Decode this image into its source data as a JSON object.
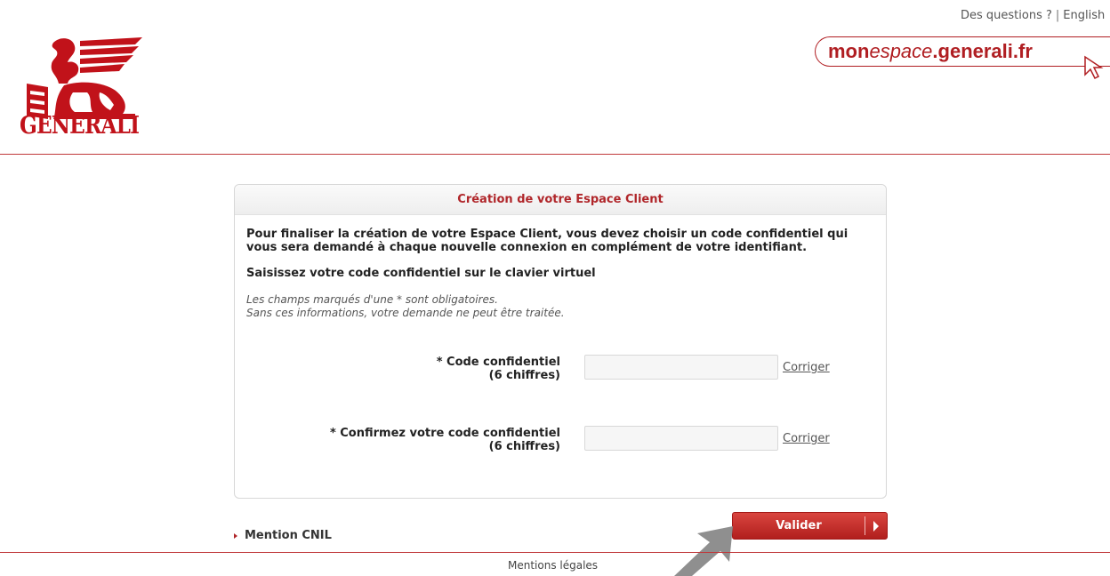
{
  "topbar": {
    "questions_label": "Des questions ?",
    "separator": "|",
    "language_label": "English"
  },
  "logo": {
    "brand": "GENERALI",
    "color": "#c1121a"
  },
  "badge": {
    "part1": "mon",
    "part2": "espace",
    "part3": ".generali.fr",
    "color": "#b01e22"
  },
  "panel": {
    "title": "Création de votre Espace Client",
    "intro": "Pour finaliser la création de votre Espace Client, vous devez choisir un code confidentiel qui vous sera demandé à chaque nouvelle connexion en complément de votre identifiant.",
    "instruction": "Saisissez votre code confidentiel sur le clavier virtuel",
    "note_line1": "Les champs marqués d'une * sont obligatoires.",
    "note_line2": "Sans ces informations, votre demande ne peut être traitée.",
    "fields": [
      {
        "label": "* Code confidentiel",
        "sublabel": "(6 chiffres)",
        "value": "",
        "fix_label": "Corriger"
      },
      {
        "label": "* Confirmez votre code confidentiel",
        "sublabel": "(6 chiffres)",
        "value": "",
        "fix_label": "Corriger"
      }
    ]
  },
  "actions": {
    "cnil_label": "Mention CNIL",
    "submit_label": "Valider",
    "accent": "#b11f1d"
  },
  "footer": {
    "legal_label": "Mentions légales"
  }
}
